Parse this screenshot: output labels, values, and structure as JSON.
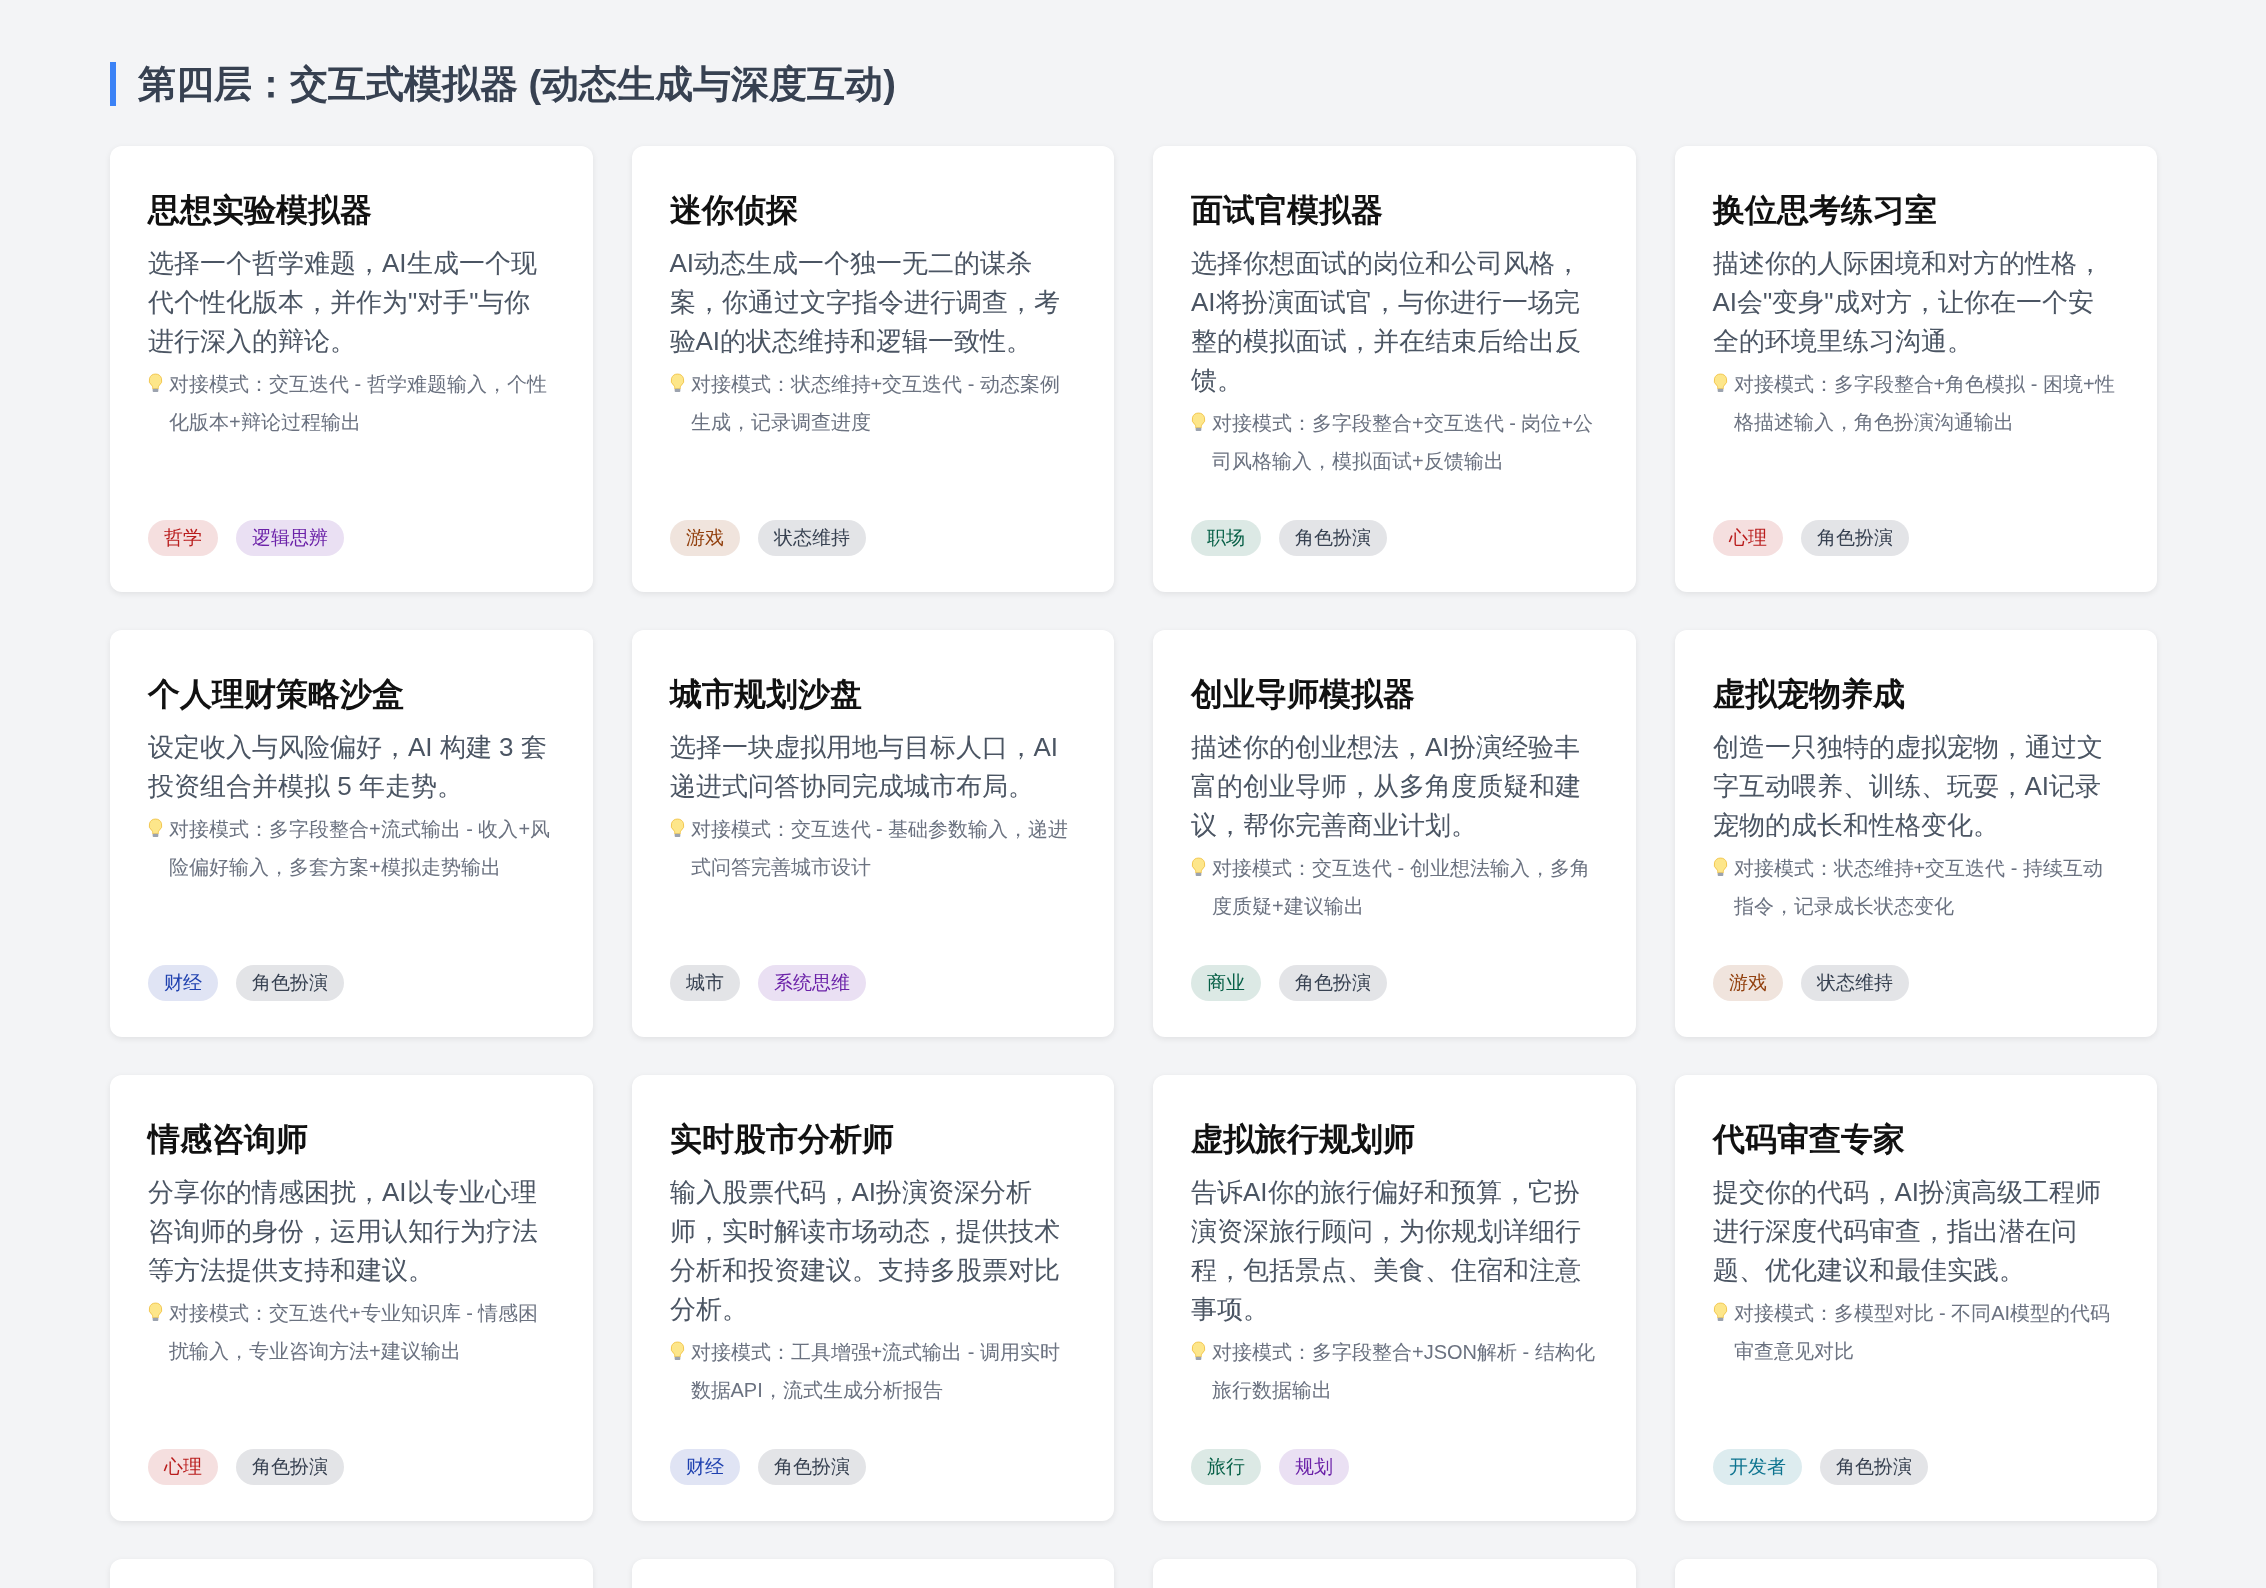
{
  "section_title": "第四层：交互式模拟器 (动态生成与深度互动)",
  "cards": [
    {
      "title": "思想实验模拟器",
      "description": "选择一个哲学难题，AI生成一个现代个性化版本，并作为\"对手\"与你进行深入的辩论。",
      "hint": "对接模式：交互迭代 - 哲学难题输入，个性化版本+辩论过程输出",
      "tags": [
        {
          "label": "哲学",
          "color": "#b91c1c"
        },
        {
          "label": "逻辑思辨",
          "color": "#6b21a8"
        }
      ]
    },
    {
      "title": "迷你侦探",
      "description": "AI动态生成一个独一无二的谋杀案，你通过文字指令进行调查，考验AI的状态维持和逻辑一致性。",
      "hint": "对接模式：状态维持+交互迭代 - 动态案例生成，记录调查进度",
      "tags": [
        {
          "label": "游戏",
          "color": "#92400e"
        },
        {
          "label": "状态维持",
          "color": "#374151"
        }
      ]
    },
    {
      "title": "面试官模拟器",
      "description": "选择你想面试的岗位和公司风格，AI将扮演面试官，与你进行一场完整的模拟面试，并在结束后给出反馈。",
      "hint": "对接模式：多字段整合+交互迭代 - 岗位+公司风格输入，模拟面试+反馈输出",
      "tags": [
        {
          "label": "职场",
          "color": "#065f46"
        },
        {
          "label": "角色扮演",
          "color": "#374151"
        }
      ]
    },
    {
      "title": "换位思考练习室",
      "description": "描述你的人际困境和对方的性格，AI会\"变身\"成对方，让你在一个安全的环境里练习沟通。",
      "hint": "对接模式：多字段整合+角色模拟 - 困境+性格描述输入，角色扮演沟通输出",
      "tags": [
        {
          "label": "心理",
          "color": "#b91c1c"
        },
        {
          "label": "角色扮演",
          "color": "#374151"
        }
      ]
    },
    {
      "title": "个人理财策略沙盒",
      "description": "设定收入与风险偏好，AI 构建 3 套投资组合并模拟 5 年走势。",
      "hint": "对接模式：多字段整合+流式输出 - 收入+风险偏好输入，多套方案+模拟走势输出",
      "tags": [
        {
          "label": "财经",
          "color": "#1e40af"
        },
        {
          "label": "角色扮演",
          "color": "#374151"
        }
      ]
    },
    {
      "title": "城市规划沙盘",
      "description": "选择一块虚拟用地与目标人口，AI递进式问答协同完成城市布局。",
      "hint": "对接模式：交互迭代 - 基础参数输入，递进式问答完善城市设计",
      "tags": [
        {
          "label": "城市",
          "color": "#374151"
        },
        {
          "label": "系统思维",
          "color": "#6b21a8"
        }
      ]
    },
    {
      "title": "创业导师模拟器",
      "description": "描述你的创业想法，AI扮演经验丰富的创业导师，从多角度质疑和建议，帮你完善商业计划。",
      "hint": "对接模式：交互迭代 - 创业想法输入，多角度质疑+建议输出",
      "tags": [
        {
          "label": "商业",
          "color": "#065f46"
        },
        {
          "label": "角色扮演",
          "color": "#374151"
        }
      ]
    },
    {
      "title": "虚拟宠物养成",
      "description": "创造一只独特的虚拟宠物，通过文字互动喂养、训练、玩耍，AI记录宠物的成长和性格变化。",
      "hint": "对接模式：状态维持+交互迭代 - 持续互动指令，记录成长状态变化",
      "tags": [
        {
          "label": "游戏",
          "color": "#92400e"
        },
        {
          "label": "状态维持",
          "color": "#374151"
        }
      ]
    },
    {
      "title": "情感咨询师",
      "description": "分享你的情感困扰，AI以专业心理咨询师的身份，运用认知行为疗法等方法提供支持和建议。",
      "hint": "对接模式：交互迭代+专业知识库 - 情感困扰输入，专业咨询方法+建议输出",
      "tags": [
        {
          "label": "心理",
          "color": "#b91c1c"
        },
        {
          "label": "角色扮演",
          "color": "#374151"
        }
      ]
    },
    {
      "title": "实时股市分析师",
      "description": "输入股票代码，AI扮演资深分析师，实时解读市场动态，提供技术分析和投资建议。支持多股票对比分析。",
      "hint": "对接模式：工具增强+流式输出 - 调用实时数据API，流式生成分析报告",
      "tags": [
        {
          "label": "财经",
          "color": "#1e40af"
        },
        {
          "label": "角色扮演",
          "color": "#374151"
        }
      ]
    },
    {
      "title": "虚拟旅行规划师",
      "description": "告诉AI你的旅行偏好和预算，它扮演资深旅行顾问，为你规划详细行程，包括景点、美食、住宿和注意事项。",
      "hint": "对接模式：多字段整合+JSON解析 - 结构化旅行数据输出",
      "tags": [
        {
          "label": "旅行",
          "color": "#065f46"
        },
        {
          "label": "规划",
          "color": "#6b21a8"
        }
      ]
    },
    {
      "title": "代码审查专家",
      "description": "提交你的代码，AI扮演高级工程师进行深度代码审查，指出潜在问题、优化建议和最佳实践。",
      "hint": "对接模式：多模型对比 - 不同AI模型的代码审查意见对比",
      "tags": [
        {
          "label": "开发者",
          "color": "#0e7490"
        },
        {
          "label": "角色扮演",
          "color": "#374151"
        }
      ]
    }
  ],
  "partial_cards": [
    {
      "kind": "card"
    },
    {
      "kind": "card"
    },
    {
      "kind": "card"
    },
    {
      "kind": "card"
    }
  ]
}
